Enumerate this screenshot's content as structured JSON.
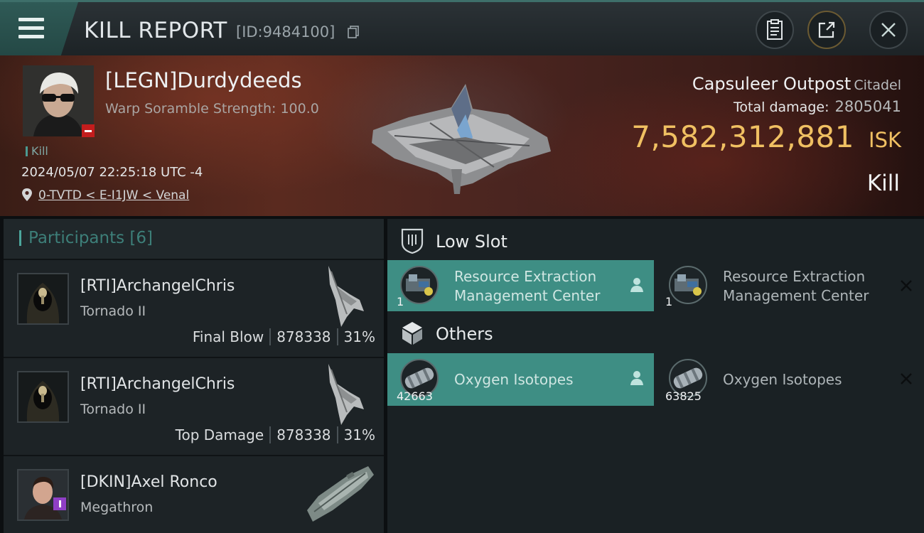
{
  "header": {
    "title": "KILL REPORT",
    "id_text": "[ID:9484100]"
  },
  "victim": {
    "name": "[LEGN]Durdydeeds",
    "scramble": "Warp Soramble Strength: 100.0",
    "tag": "Kill",
    "datetime": "2024/05/07 22:25:18 UTC -4",
    "location": "0-TVTD < E-I1JW < Venal",
    "structure_name": "Capsuleer Outpost",
    "structure_class": "Citadel",
    "total_damage_label": "Total damage:",
    "total_damage": "2805041",
    "isk_value": "7,582,312,881",
    "isk_unit": "ISK",
    "result": "Kill"
  },
  "participants": {
    "label": "Participants",
    "count": "[6]",
    "rows": [
      {
        "name": "[RTI]ArchangelChris",
        "ship": "Tornado II",
        "role": "Final Blow",
        "damage": "878338",
        "pct": "31%"
      },
      {
        "name": "[RTI]ArchangelChris",
        "ship": "Tornado II",
        "role": "Top Damage",
        "damage": "878338",
        "pct": "31%"
      },
      {
        "name": "[DKIN]Axel Ronco",
        "ship": "Megathron"
      }
    ]
  },
  "fitting": {
    "low_slot": {
      "label": "Low Slot",
      "items": [
        {
          "name_line1": "Resource Extraction",
          "name_line2": "Management Center",
          "qty": "1",
          "status": "destroyed"
        },
        {
          "name_line1": "Resource Extraction",
          "name_line2": "Management Center",
          "qty": "1",
          "status": "dropped"
        }
      ]
    },
    "others": {
      "label": "Others",
      "items": [
        {
          "name": "Oxygen Isotopes",
          "qty": "42663",
          "status": "destroyed"
        },
        {
          "name": "Oxygen Isotopes",
          "qty": "63825",
          "status": "dropped"
        }
      ]
    }
  },
  "colors": {
    "accent_teal": "#3e8e84",
    "isk_gold": "#f0c062",
    "danger_red": "#c31d1d"
  }
}
